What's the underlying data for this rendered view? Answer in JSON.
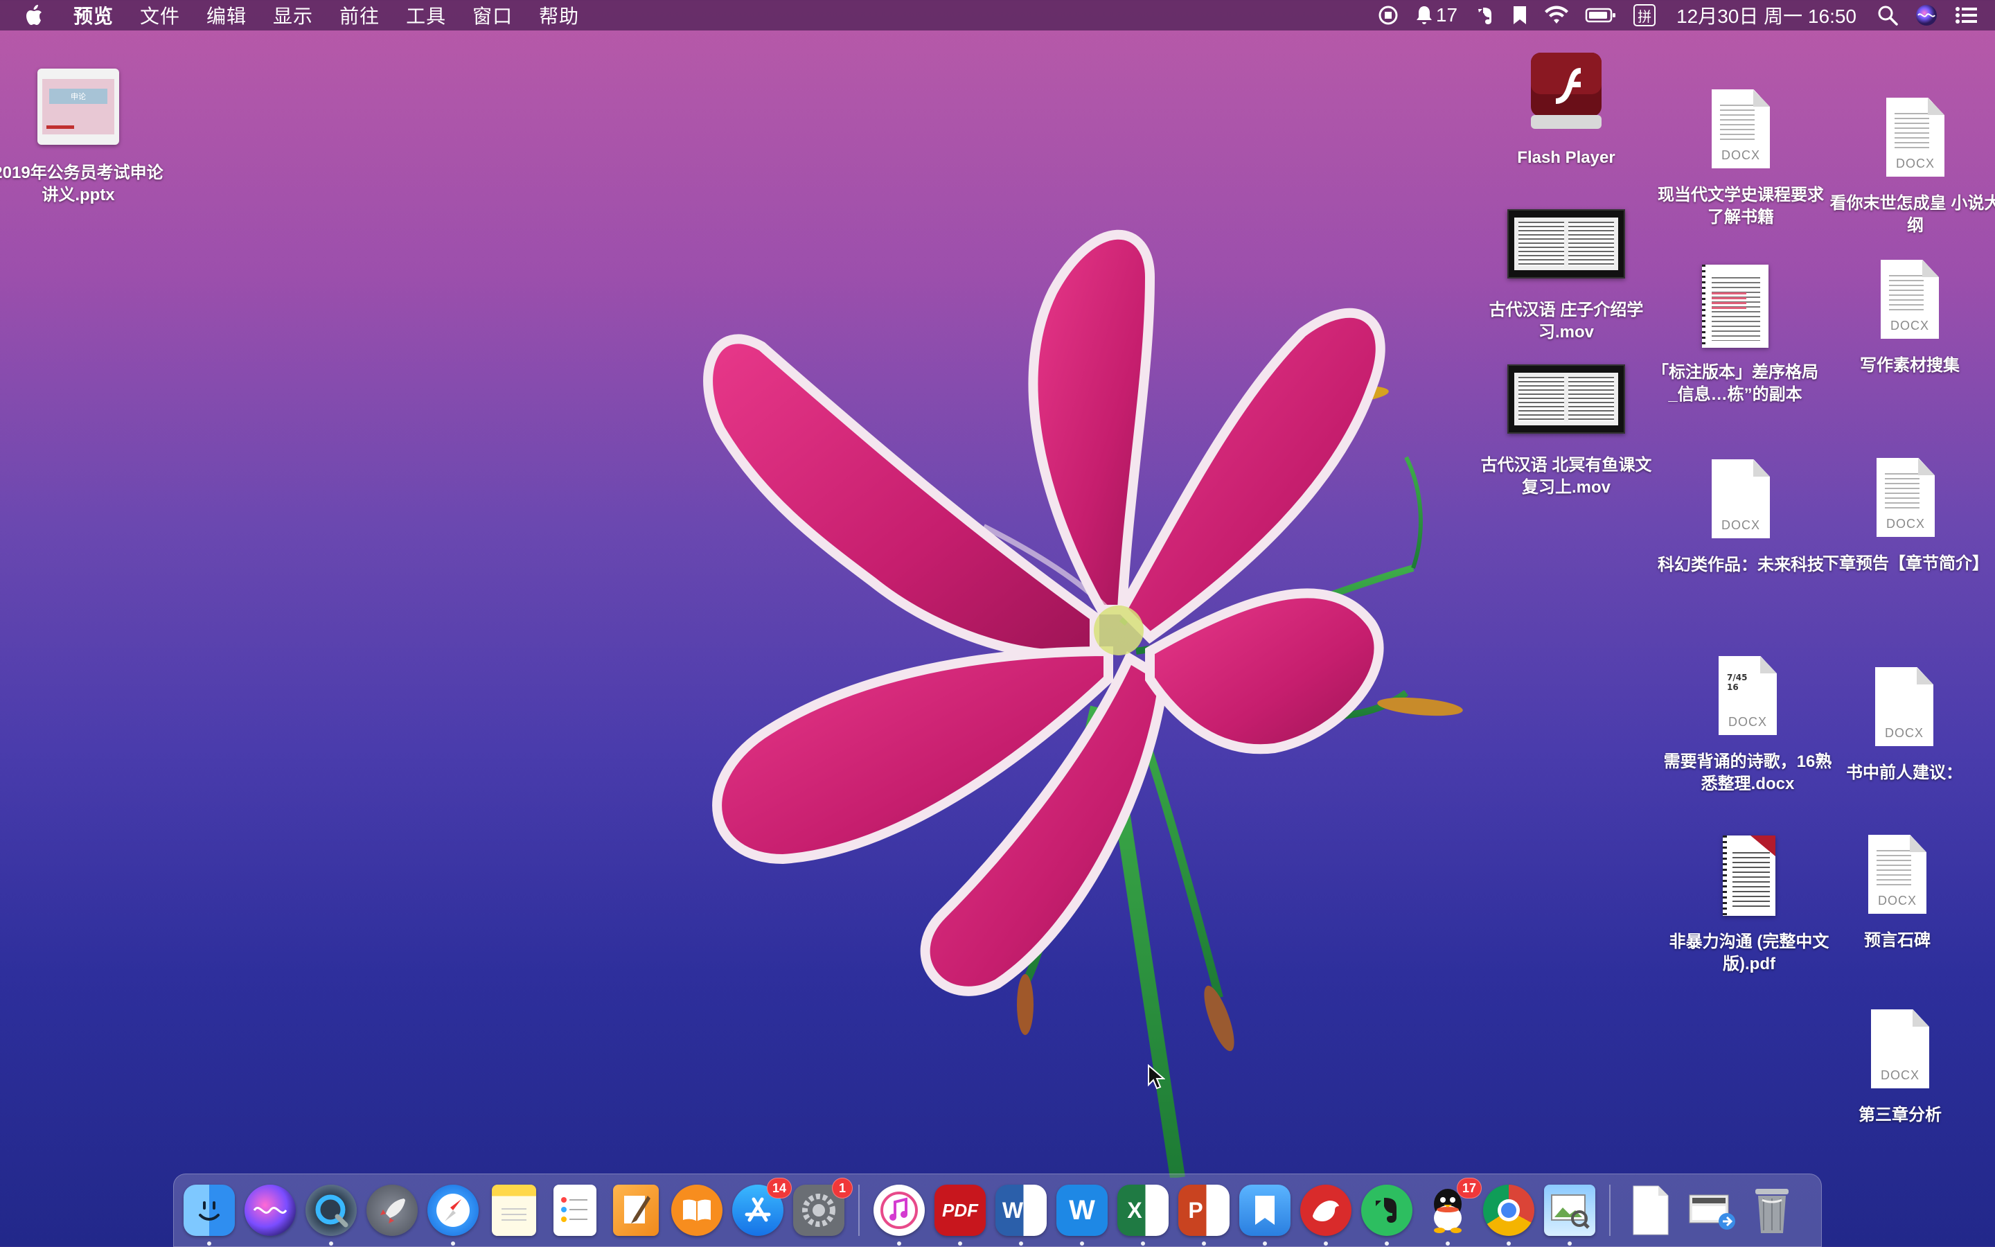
{
  "menubar": {
    "app_name": "预览",
    "menus": [
      "文件",
      "编辑",
      "显示",
      "前往",
      "工具",
      "窗口",
      "帮助"
    ],
    "notification_count": "17",
    "datetime": "12月30日 周一 16:50",
    "input_method": "拼"
  },
  "desktop": {
    "left_icons": [
      {
        "label": "2019年公务员考试申论讲义.pptx",
        "thumb_text": "申论"
      }
    ],
    "col1": [
      {
        "label": "Flash Player",
        "kind": "flash"
      },
      {
        "label": "古代汉语 庄子介绍学习.mov",
        "kind": "video"
      },
      {
        "label": "古代汉语 北冥有鱼课文复习上.mov",
        "kind": "video"
      }
    ],
    "col2": [
      {
        "label": "现当代文学史课程要求了解书籍",
        "kind": "docx",
        "ext": "DOCX"
      },
      {
        "label": "「标注版本」差序格局_信息…栋”的副本",
        "kind": "annotated"
      },
      {
        "label": "科幻类作品：未来科技",
        "kind": "docx",
        "ext": "DOCX"
      },
      {
        "label": "需要背诵的诗歌，16熟悉整理.docx",
        "kind": "docx",
        "ext": "DOCX",
        "corner": "7/45\n16"
      },
      {
        "label": "非暴力沟通 (完整中文版).pdf",
        "kind": "pdf"
      }
    ],
    "col3": [
      {
        "label": "看你末世怎成皇 小说大纲",
        "kind": "docx",
        "ext": "DOCX"
      },
      {
        "label": "写作素材搜集",
        "kind": "docx",
        "ext": "DOCX"
      },
      {
        "label": "下章预告【章节简介】",
        "kind": "docx",
        "ext": "DOCX"
      },
      {
        "label": "书中前人建议：",
        "kind": "docx",
        "ext": "DOCX",
        "blank": true
      },
      {
        "label": "预言石碑",
        "kind": "docx",
        "ext": "DOCX"
      },
      {
        "label": "第三章分析",
        "kind": "docx",
        "ext": "DOCX",
        "blank": true
      }
    ]
  },
  "dock": {
    "apps": [
      {
        "name": "Finder",
        "icon": "finder-icon",
        "running": true
      },
      {
        "name": "Siri",
        "icon": "siri-icon",
        "running": false
      },
      {
        "name": "QuickTime Player",
        "icon": "quicktime-icon",
        "running": true
      },
      {
        "name": "Launchpad",
        "icon": "launchpad-icon",
        "running": false
      },
      {
        "name": "Safari",
        "icon": "safari-icon",
        "running": true
      },
      {
        "name": "Notes",
        "icon": "notes-icon",
        "running": false
      },
      {
        "name": "Reminders",
        "icon": "reminders-icon",
        "running": false
      },
      {
        "name": "Pages",
        "icon": "pages-icon",
        "running": false
      },
      {
        "name": "Books",
        "icon": "books-icon",
        "running": false
      },
      {
        "name": "App Store",
        "icon": "appstore-icon",
        "running": false,
        "badge": "14"
      },
      {
        "name": "System Preferences",
        "icon": "settings-icon",
        "running": false,
        "badge": "1"
      },
      {
        "name": "iTunes",
        "icon": "itunes-icon",
        "running": true
      },
      {
        "name": "PDF Reader",
        "icon": "pdf-app-icon",
        "running": true,
        "text": "PDF"
      },
      {
        "name": "Microsoft Word",
        "icon": "word-icon",
        "running": true,
        "text": "W"
      },
      {
        "name": "WPS Office",
        "icon": "wps-icon",
        "running": true,
        "text": "W"
      },
      {
        "name": "Microsoft Excel",
        "icon": "excel-icon",
        "running": true,
        "text": "X"
      },
      {
        "name": "Microsoft PowerPoint",
        "icon": "powerpoint-icon",
        "running": true,
        "text": "P"
      },
      {
        "name": "Bookmarks",
        "icon": "bookmark-app-icon",
        "running": true
      },
      {
        "name": "Bear",
        "icon": "bear-app-icon",
        "running": true
      },
      {
        "name": "Evernote",
        "icon": "evernote-icon",
        "running": true
      },
      {
        "name": "QQ",
        "icon": "qq-icon",
        "running": true,
        "badge": "17"
      },
      {
        "name": "Google Chrome",
        "icon": "chrome-icon",
        "running": true
      },
      {
        "name": "Preview",
        "icon": "preview-icon",
        "running": true
      }
    ],
    "stacks": [
      {
        "name": "Documents",
        "icon": "document-stack-icon"
      },
      {
        "name": "Downloads",
        "icon": "downloads-stack-icon"
      },
      {
        "name": "Trash",
        "icon": "trash-icon"
      }
    ]
  },
  "colors": {
    "menubar_bg": "#5c2860",
    "wallpaper_top": "#b95aa8",
    "wallpaper_bottom": "#22288a",
    "petal": "#d42f7f",
    "badge": "#f0383a"
  }
}
